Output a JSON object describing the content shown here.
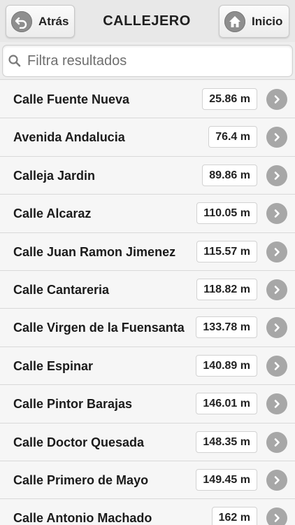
{
  "header": {
    "back_label": "Atrás",
    "title": "CALLEJERO",
    "home_label": "Inicio"
  },
  "search": {
    "placeholder": "Filtra resultados",
    "value": ""
  },
  "streets": [
    {
      "name": "Calle Fuente Nueva",
      "distance": "25.86 m"
    },
    {
      "name": "Avenida Andalucia",
      "distance": "76.4 m"
    },
    {
      "name": "Calleja Jardin",
      "distance": "89.86 m"
    },
    {
      "name": "Calle Alcaraz",
      "distance": "110.05 m"
    },
    {
      "name": "Calle Juan Ramon Jimenez",
      "distance": "115.57 m"
    },
    {
      "name": "Calle Cantareria",
      "distance": "118.82 m"
    },
    {
      "name": "Calle Virgen de la Fuensanta",
      "distance": "133.78 m"
    },
    {
      "name": "Calle Espinar",
      "distance": "140.89 m"
    },
    {
      "name": "Calle Pintor Barajas",
      "distance": "146.01 m"
    },
    {
      "name": "Calle Doctor Quesada",
      "distance": "148.35 m"
    },
    {
      "name": "Calle Primero de Mayo",
      "distance": "149.45 m"
    },
    {
      "name": "Calle Antonio Machado",
      "distance": "162 m"
    }
  ],
  "icons": {
    "back": "back-arrow-icon",
    "home": "home-icon",
    "search": "search-icon",
    "row_chevron": "chevron-right-icon"
  },
  "colors": {
    "icon_gray": "#8e8e8e",
    "chevron_gray": "#a7a7a7",
    "row_background": "#f6f6f6"
  }
}
